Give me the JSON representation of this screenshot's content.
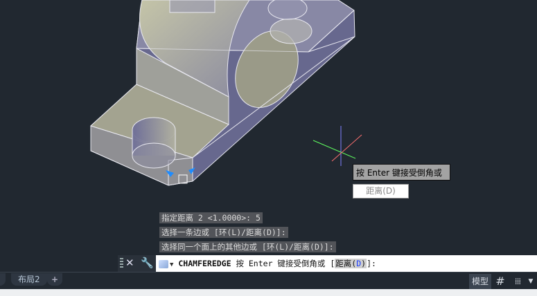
{
  "command_history": [
    "指定距离 2 <1.0000>: 5",
    "选择一条边或 [环(L)/距离(D)]:",
    "选择同一个面上的其他边或 [环(L)/距离(D)]:"
  ],
  "command_line": {
    "command_name": "CHAMFEREDGE",
    "prompt_text": " 按 Enter 键接受倒角或 [",
    "option_label": "距离(",
    "option_key": "D",
    "option_close": ")",
    "prompt_end": "]:"
  },
  "tooltip": {
    "prompt": "按 Enter 键接受倒角或",
    "option": "距离(D)"
  },
  "layout_tabs": {
    "tab": "布局2",
    "add": "+"
  },
  "status_bar": {
    "model_label": "模型"
  },
  "colors": {
    "background": "#212830",
    "solid_side": "#6c6c94",
    "solid_top": "#a7a790",
    "grip": "#1e8cff"
  }
}
